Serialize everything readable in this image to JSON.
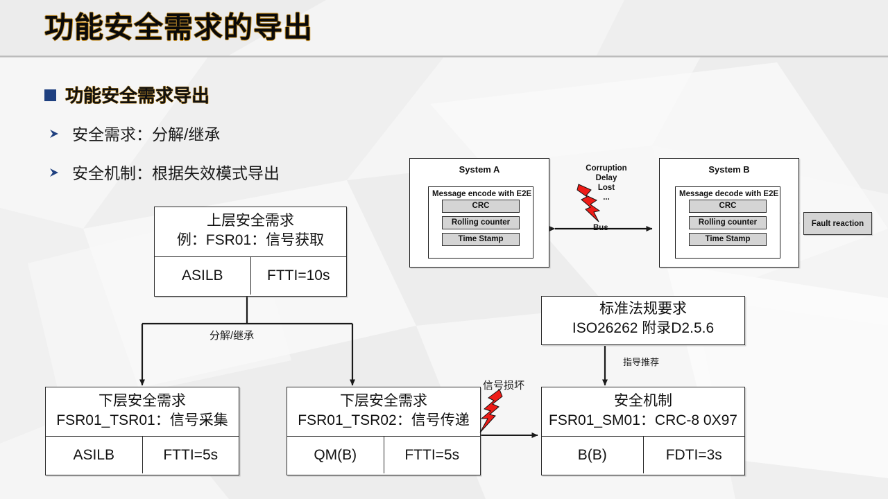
{
  "slide": {
    "title": "功能安全需求的导出",
    "accent_outline": "#c8922a",
    "bullet_color": "#1f4080",
    "background": "#f0f0f0"
  },
  "outline": {
    "heading": "功能安全需求导出",
    "items": [
      {
        "text": "安全需求：分解/继承"
      },
      {
        "text": "安全机制：根据失效模式导出"
      }
    ]
  },
  "diagram": {
    "top_requirement": {
      "title": "上层安全需求",
      "subtitle": "例：FSR01：信号获取",
      "cells": [
        "ASILB",
        "FTTI=10s"
      ]
    },
    "lower_requirement_1": {
      "title": "下层安全需求",
      "subtitle": "FSR01_TSR01：信号采集",
      "cells": [
        "ASILB",
        "FTTI=5s"
      ]
    },
    "lower_requirement_2": {
      "title": "下层安全需求",
      "subtitle": "FSR01_TSR02：信号传递",
      "cells": [
        "QM(B)",
        "FTTI=5s"
      ]
    },
    "standard": {
      "title": "标准法规要求",
      "subtitle": "ISO26262 附录D2.5.6"
    },
    "safety_mechanism": {
      "title": "安全机制",
      "subtitle": "FSR01_SM01：CRC-8 0X97",
      "cells": [
        "B(B)",
        "FDTI=3s"
      ]
    },
    "connector_labels": {
      "decompose": "分解/继承",
      "guidance": "指导推荐",
      "signal_corruption": "信号损坏"
    }
  },
  "e2e": {
    "system_a": {
      "title": "System A",
      "message_label": "Message  encode with E2E",
      "chips": [
        "CRC",
        "Rolling counter",
        "Time Stamp"
      ]
    },
    "system_b": {
      "title": "System B",
      "message_label": "Message decode with E2E",
      "chips": [
        "CRC",
        "Rolling counter",
        "Time Stamp"
      ]
    },
    "fault_reaction": "Fault reaction",
    "bus": {
      "label": "Bus",
      "failure_modes": [
        "Corruption",
        "Delay",
        "Lost",
        "..."
      ]
    },
    "bolt_color": "#ee1c17"
  }
}
